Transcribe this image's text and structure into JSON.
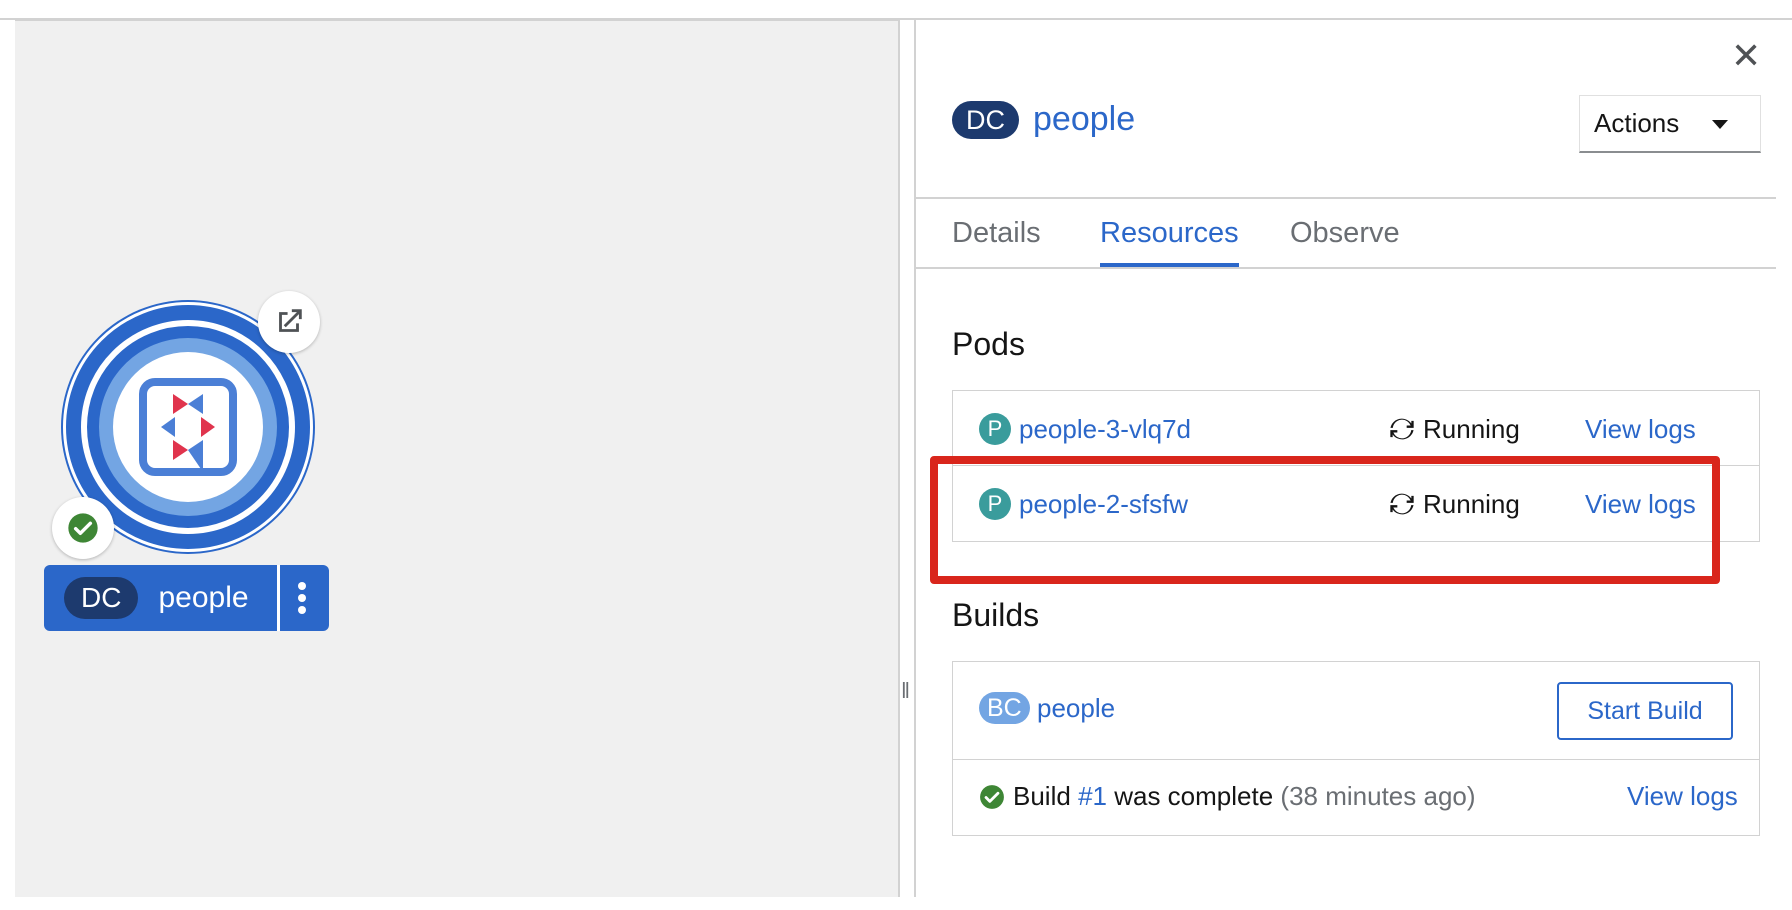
{
  "node": {
    "kind_badge": "DC",
    "name": "people"
  },
  "panel": {
    "kind_badge": "DC",
    "title": "people",
    "actions_label": "Actions",
    "tabs": [
      {
        "label": "Details"
      },
      {
        "label": "Resources"
      },
      {
        "label": "Observe"
      }
    ],
    "active_tab": "Resources"
  },
  "pods": {
    "title": "Pods",
    "items": [
      {
        "badge": "P",
        "name": "people-3-vlq7d",
        "status": "Running",
        "logs_label": "View logs"
      },
      {
        "badge": "P",
        "name": "people-2-sfsfw",
        "status": "Running",
        "logs_label": "View logs"
      }
    ]
  },
  "builds": {
    "title": "Builds",
    "config_badge": "BC",
    "config_name": "people",
    "start_build_label": "Start Build",
    "last_build": {
      "prefix": "Build",
      "number": "#1",
      "status_text": "was complete",
      "age": "(38 minutes ago)",
      "logs_label": "View logs"
    }
  },
  "colors": {
    "accent": "#2b67c9",
    "badge_dark": "#1d3a6e",
    "pod_badge": "#3a9c9c",
    "success": "#3e8635",
    "highlight": "#d9261c"
  }
}
